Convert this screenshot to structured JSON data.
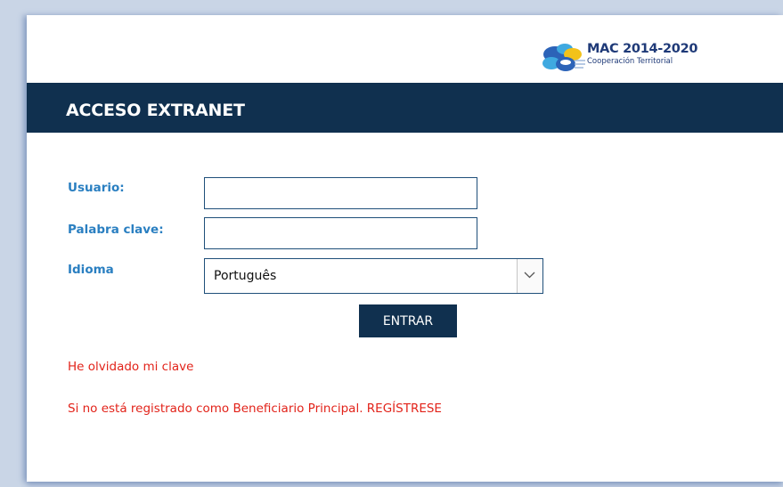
{
  "logo": {
    "title": "MAC 2014-2020",
    "subtitle": "Cooperación Territorial",
    "colors": {
      "blue": "#2c63b8",
      "cyan": "#3fa9e0",
      "yellow": "#f2c21a",
      "text": "#1f3a78"
    }
  },
  "header": {
    "title": "ACCESO EXTRANET"
  },
  "form": {
    "username_label": "Usuario:",
    "username_value": "",
    "password_label": "Palabra clave:",
    "password_value": "",
    "language_label": "Idioma",
    "language_selected": "Português",
    "language_arrow_icon": "chevron-down-icon",
    "submit_label": "ENTRAR"
  },
  "links": {
    "forgot_password": "He olvidado mi clave",
    "register": "Si no está registrado como Beneficiario Principal. REGÍSTRESE"
  },
  "colors": {
    "header_bg": "#10304f",
    "label": "#2a7fc1",
    "link": "#e2231a",
    "page_bg": "#c9d5e6"
  }
}
